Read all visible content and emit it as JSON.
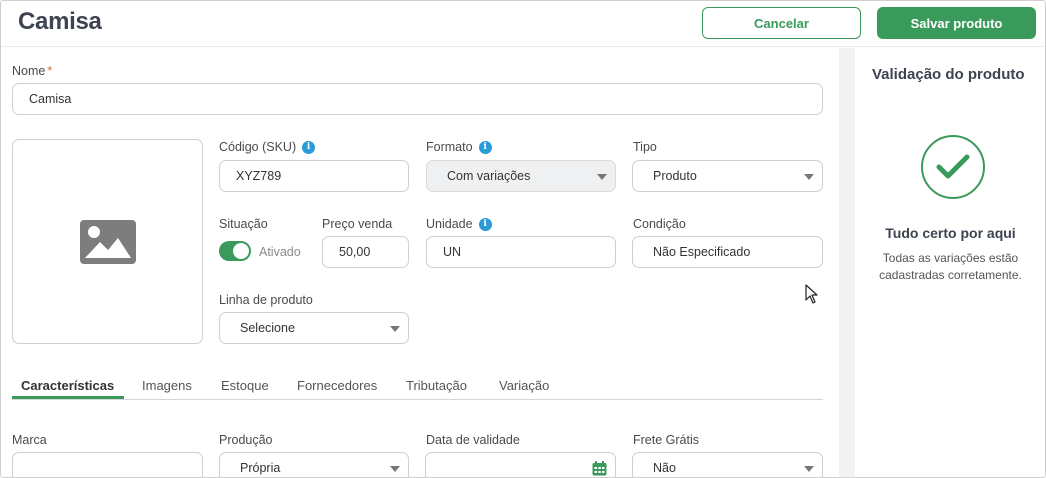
{
  "header": {
    "title": "Camisa",
    "cancel_label": "Cancelar",
    "save_label": "Salvar produto"
  },
  "form": {
    "nome": {
      "label": "Nome",
      "required_mark": "*",
      "value": "Camisa"
    },
    "image_placeholder_icon": "image-icon",
    "sku": {
      "label": "Código (SKU)",
      "value": "XYZ789",
      "info_icon": "info-icon"
    },
    "formato": {
      "label": "Formato",
      "value": "Com variações",
      "info_icon": "info-icon",
      "disabled": true
    },
    "tipo": {
      "label": "Tipo",
      "value": "Produto"
    },
    "situacao": {
      "label": "Situação",
      "toggle_state": "Ativado",
      "on": true
    },
    "preco_venda": {
      "label": "Preço venda",
      "value": "50,00"
    },
    "unidade": {
      "label": "Unidade",
      "value": "UN",
      "info_icon": "info-icon"
    },
    "condicao": {
      "label": "Condição",
      "value": "Não Especificado"
    },
    "linha_produto": {
      "label": "Linha de produto",
      "value": "Selecione"
    }
  },
  "tabs": [
    {
      "label": "Características",
      "active": true
    },
    {
      "label": "Imagens"
    },
    {
      "label": "Estoque"
    },
    {
      "label": "Fornecedores"
    },
    {
      "label": "Tributação"
    },
    {
      "label": "Variação"
    }
  ],
  "characteristics": {
    "marca": {
      "label": "Marca",
      "value": ""
    },
    "producao": {
      "label": "Produção",
      "value": "Própria"
    },
    "data_validade": {
      "label": "Data de validade",
      "value": "",
      "icon": "calendar-icon"
    },
    "frete_gratis": {
      "label": "Frete Grátis",
      "value": "Não"
    }
  },
  "validation": {
    "title": "Validação do produto",
    "status_icon": "check-icon",
    "status_title": "Tudo certo por aqui",
    "status_text": "Todas as variações estão cadastradas corretamente."
  },
  "colors": {
    "accent": "#3a9a5b",
    "info": "#2b9ad9",
    "required": "#e06b3a",
    "title": "#3d4350"
  }
}
